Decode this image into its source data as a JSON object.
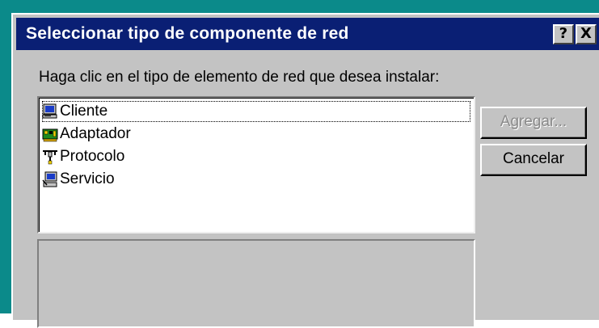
{
  "window": {
    "title": "Seleccionar tipo de componente de red",
    "help_button_label": "?",
    "close_button_label": "X"
  },
  "instruction": "Haga clic en el tipo de elemento de red que desea instalar:",
  "list": {
    "items": [
      {
        "label": "Cliente",
        "icon": "computer-icon",
        "selected": true
      },
      {
        "label": "Adaptador",
        "icon": "network-card-icon",
        "selected": false
      },
      {
        "label": "Protocolo",
        "icon": "network-cable-icon",
        "selected": false
      },
      {
        "label": "Servicio",
        "icon": "server-icon",
        "selected": false
      }
    ]
  },
  "buttons": {
    "add_label": "Agregar...",
    "add_enabled": false,
    "cancel_label": "Cancelar"
  },
  "colors": {
    "title_bar": "#0a1f74",
    "dialog_face": "#c3c3c3",
    "desktop": "#0b8a8a"
  }
}
